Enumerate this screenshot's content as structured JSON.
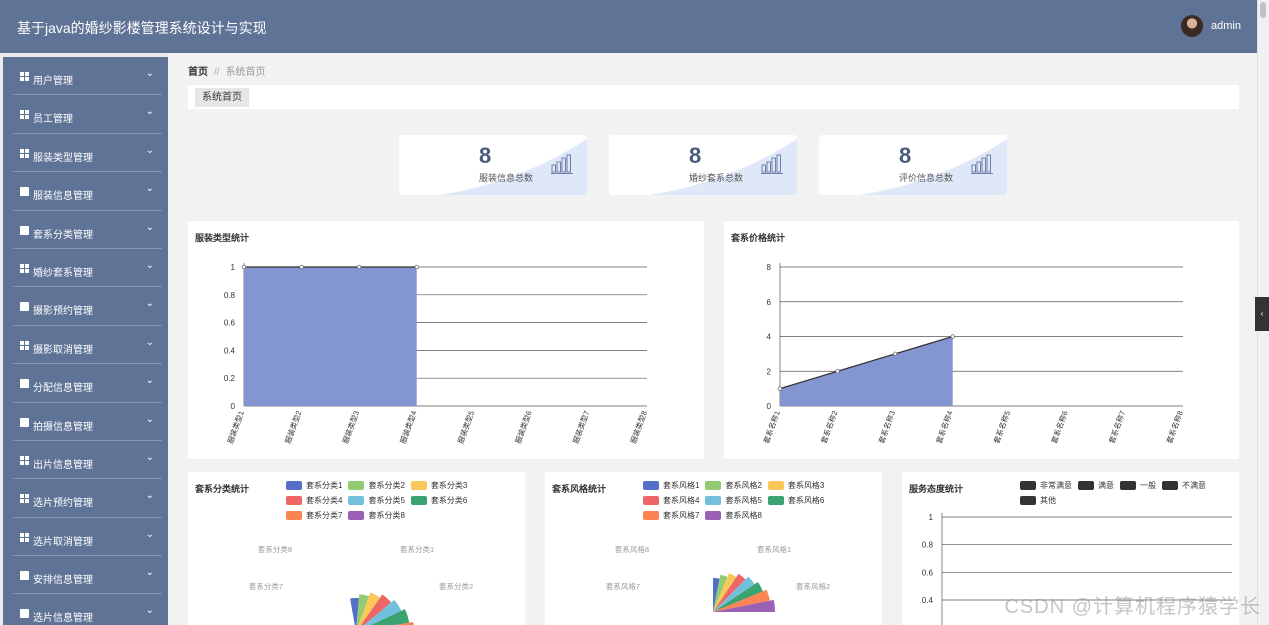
{
  "app": {
    "title": "基于java的婚纱影楼管理系统设计与实现",
    "user": "admin"
  },
  "sidebar": {
    "items": [
      {
        "label": "用户管理",
        "icon": "grid-icon"
      },
      {
        "label": "员工管理",
        "icon": "grid-icon"
      },
      {
        "label": "服装类型管理",
        "icon": "grid-icon"
      },
      {
        "label": "服装信息管理",
        "icon": "monitor-icon"
      },
      {
        "label": "套系分类管理",
        "icon": "comment-icon"
      },
      {
        "label": "婚纱套系管理",
        "icon": "grid-icon"
      },
      {
        "label": "摄影预约管理",
        "icon": "clipboard-icon"
      },
      {
        "label": "摄影取消管理",
        "icon": "grid-icon"
      },
      {
        "label": "分配信息管理",
        "icon": "clipboard-icon"
      },
      {
        "label": "拍摄信息管理",
        "icon": "monitor-icon"
      },
      {
        "label": "出片信息管理",
        "icon": "grid-icon"
      },
      {
        "label": "选片预约管理",
        "icon": "grid-icon"
      },
      {
        "label": "选片取消管理",
        "icon": "grid-icon"
      },
      {
        "label": "安排信息管理",
        "icon": "check-icon"
      },
      {
        "label": "选片信息管理",
        "icon": "list-icon"
      }
    ]
  },
  "breadcrumb": {
    "home": "首页",
    "sep": "//",
    "current": "系统首页"
  },
  "tabs": [
    {
      "label": "系统首页"
    }
  ],
  "stats": [
    {
      "value": "8",
      "label": "服装信息总数"
    },
    {
      "value": "8",
      "label": "婚纱套系总数"
    },
    {
      "value": "8",
      "label": "评价信息总数"
    }
  ],
  "colors": {
    "header": "#5f7396",
    "area": "#8496d2",
    "palette": [
      "#5470c6",
      "#91cc75",
      "#fac858",
      "#ee6666",
      "#73c0de",
      "#3ba272",
      "#fc8452",
      "#9a60b4"
    ]
  },
  "chart_data": [
    {
      "type": "area",
      "title": "服装类型统计",
      "categories": [
        "服装类型1",
        "服装类型2",
        "服装类型3",
        "服装类型4",
        "服装类型5",
        "服装类型6",
        "服装类型7",
        "服装类型8"
      ],
      "values": [
        1,
        1,
        1,
        1,
        null,
        null,
        null,
        null
      ],
      "yticks": [
        "0",
        "0.2",
        "0.4",
        "0.6",
        "0.8",
        "1"
      ],
      "ylim": [
        0,
        1
      ]
    },
    {
      "type": "area",
      "title": "套系价格统计",
      "categories": [
        "套系名称1",
        "套系名称2",
        "套系名称3",
        "套系名称4",
        "套系名称5",
        "套系名称6",
        "套系名称7",
        "套系名称8"
      ],
      "values": [
        1,
        2,
        3,
        4,
        null,
        null,
        null,
        null
      ],
      "yticks": [
        "0",
        "2",
        "4",
        "6",
        "8"
      ],
      "ylim": [
        0,
        8
      ]
    },
    {
      "type": "pie",
      "title": "套系分类统计",
      "legend": [
        "套系分类1",
        "套系分类2",
        "套系分类3",
        "套系分类4",
        "套系分类5",
        "套系分类6",
        "套系分类7",
        "套系分类8"
      ],
      "visible_labels": [
        "套系分类8",
        "套系分类1",
        "套系分类7",
        "套系分类2"
      ],
      "values": [
        1,
        1,
        1,
        1,
        1,
        1,
        1,
        1
      ]
    },
    {
      "type": "pie",
      "title": "套系风格统计",
      "legend": [
        "套系风格1",
        "套系风格2",
        "套系风格3",
        "套系风格4",
        "套系风格5",
        "套系风格6",
        "套系风格7",
        "套系风格8"
      ],
      "visible_labels": [
        "套系风格8",
        "套系风格1",
        "套系风格7",
        "套系风格2"
      ],
      "values": [
        1,
        1,
        1,
        1,
        1,
        1,
        1,
        1
      ]
    },
    {
      "type": "bar",
      "title": "服务态度统计",
      "legend": [
        "非常满意",
        "满意",
        "一般",
        "不满意",
        "其他"
      ],
      "yticks": [
        "0.4",
        "0.6",
        "0.8",
        "1"
      ],
      "ylim": [
        0,
        1
      ]
    }
  ],
  "watermark": "CSDN @计算机程序猿学长"
}
